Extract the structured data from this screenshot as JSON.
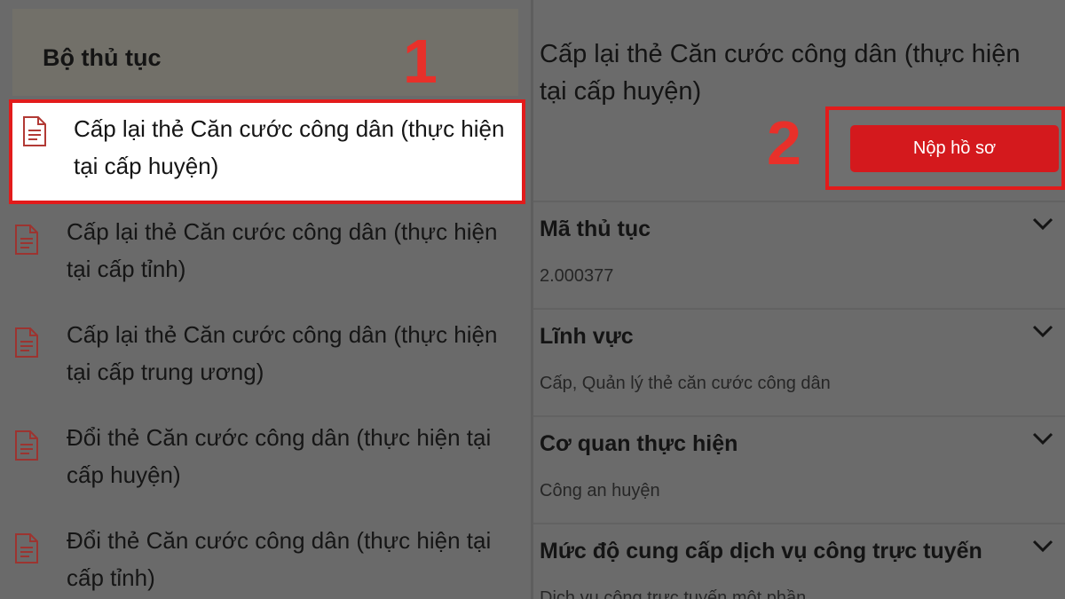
{
  "left": {
    "header": "Bộ thủ tục",
    "items": [
      {
        "label": "Cấp lại thẻ Căn cước công dân (thực hiện tại cấp huyện)"
      },
      {
        "label": "Cấp lại thẻ Căn cước công dân (thực hiện tại cấp tỉnh)"
      },
      {
        "label": "Cấp lại thẻ Căn cước công dân (thực hiện tại cấp trung ương)"
      },
      {
        "label": "Đổi thẻ Căn cước công dân (thực hiện tại cấp huyện)"
      },
      {
        "label": "Đổi thẻ Căn cước công dân (thực hiện tại cấp tỉnh)"
      }
    ]
  },
  "annotations": {
    "step1": "1",
    "step2": "2"
  },
  "detail": {
    "title": "Cấp lại thẻ Căn cước công dân (thực hiện tại cấp huyện)",
    "submit_label": "Nộp hồ sơ",
    "sections": [
      {
        "title": "Mã thủ tục",
        "value": "2.000377"
      },
      {
        "title": "Lĩnh vực",
        "value": "Cấp, Quản lý thẻ căn cước công dân"
      },
      {
        "title": "Cơ quan thực hiện",
        "value": "Công an huyện"
      },
      {
        "title": "Mức độ cung cấp dịch vụ công trực tuyến",
        "value": "Dịch vụ công trực tuyến một phần"
      }
    ]
  },
  "colors": {
    "accent": "#d4191d",
    "highlight_border": "#e21b1b",
    "step_number": "#e8302a",
    "icon": "#b23a35"
  },
  "icons": {
    "document": "document-icon",
    "chevron": "chevron-down-icon"
  }
}
